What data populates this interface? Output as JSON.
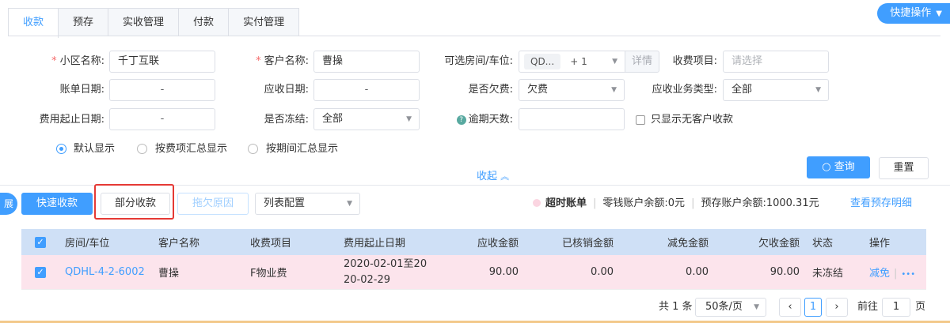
{
  "tabs": [
    "收款",
    "预存",
    "实收管理",
    "付款",
    "实付管理"
  ],
  "quick_ops": "快捷操作",
  "form": {
    "community_label": "小区名称:",
    "community_value": "千丁互联",
    "customer_label": "客户名称:",
    "customer_value": "曹操",
    "room_label": "可选房间/车位:",
    "room_tag1": "QD...",
    "room_tag2": "+ 1",
    "room_detail": "详情",
    "charge_item_label": "收费项目:",
    "charge_item_placeholder": "请选择",
    "bill_date_label": "账单日期:",
    "bill_date_value": "-",
    "receivable_date_label": "应收日期:",
    "receivable_date_value": "-",
    "arrears_label": "是否欠费:",
    "arrears_value": "欠费",
    "biz_type_label": "应收业务类型:",
    "biz_type_value": "全部",
    "fee_period_label": "费用起止日期:",
    "fee_period_value": "-",
    "frozen_label": "是否冻结:",
    "frozen_value": "全部",
    "overdue_label": "逾期天数:",
    "no_customer_label": "只显示无客户收款",
    "display_modes": [
      "默认显示",
      "按费项汇总显示",
      "按期间汇总显示"
    ],
    "collapse": "收起",
    "query": "查询",
    "reset": "重置"
  },
  "toolbar": {
    "expand": "展开",
    "quick_collect": "快速收款",
    "partial_collect": "部分收款",
    "arrears_reason": "拖欠原因",
    "list_config": "列表配置",
    "overtime_bill": "超时账单",
    "change_balance": "零钱账户余额:0元",
    "prestore_balance": "预存账户余额:1000.31元",
    "view_prestore": "查看预存明细"
  },
  "table": {
    "headers": [
      "房间/车位",
      "客户名称",
      "收费项目",
      "费用起止日期",
      "应收金额",
      "已核销金额",
      "减免金额",
      "欠收金额",
      "状态",
      "操作"
    ],
    "rows": [
      {
        "room": "QDHL-4-2-6002",
        "customer": "曹操",
        "item": "F物业费",
        "period_line1": "2020-02-01至20",
        "period_line2": "20-02-29",
        "receivable": "90.00",
        "written_off": "0.00",
        "reduced": "0.00",
        "owed": "90.00",
        "status": "未冻结",
        "action": "减免",
        "more": "•••"
      }
    ]
  },
  "pager": {
    "total": "共 1 条",
    "page_size": "50条/页",
    "current": "1",
    "goto_label": "前往",
    "goto_value": "1",
    "page_suffix": "页"
  },
  "colors": {
    "accent": "#409eff",
    "row_highlight": "#fce4ec",
    "header_bg": "#cfe0f6",
    "callout": "#e53935"
  }
}
